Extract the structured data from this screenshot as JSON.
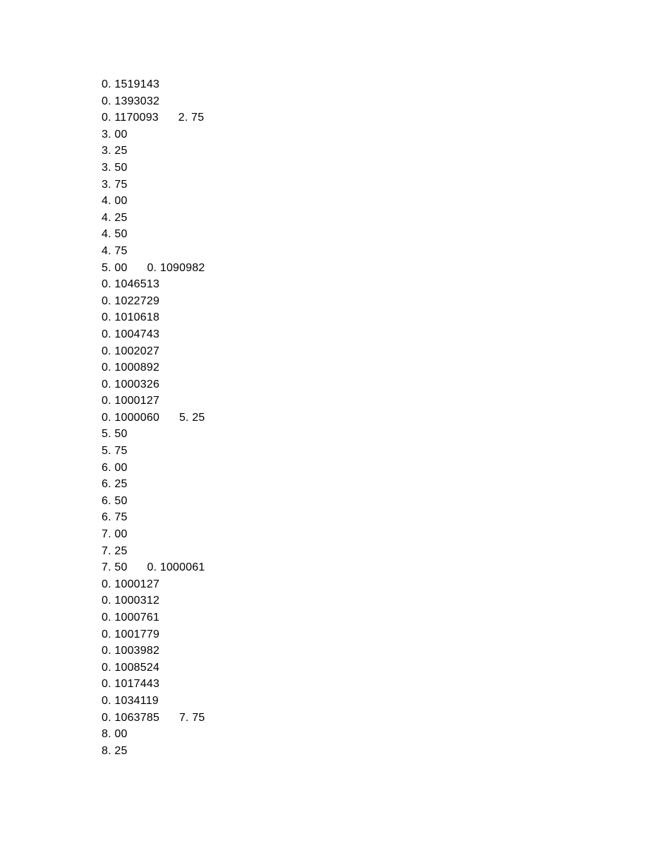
{
  "lines": [
    "0. 1519143",
    "0. 1393032",
    "0. 1170093      2. 75",
    "3. 00",
    "3. 25",
    "3. 50",
    "3. 75",
    "4. 00",
    "4. 25",
    "4. 50",
    "4. 75",
    "5. 00      0. 1090982",
    "0. 1046513",
    "0. 1022729",
    "0. 1010618",
    "0. 1004743",
    "0. 1002027",
    "0. 1000892",
    "0. 1000326",
    "0. 1000127",
    "0. 1000060      5. 25",
    "5. 50",
    "5. 75",
    "6. 00",
    "6. 25",
    "6. 50",
    "6. 75",
    "7. 00",
    "7. 25",
    "7. 50      0. 1000061",
    "0. 1000127",
    "0. 1000312",
    "0. 1000761",
    "0. 1001779",
    "0. 1003982",
    "0. 1008524",
    "0. 1017443",
    "0. 1034119",
    "0. 1063785      7. 75",
    "8. 00",
    "8. 25"
  ]
}
